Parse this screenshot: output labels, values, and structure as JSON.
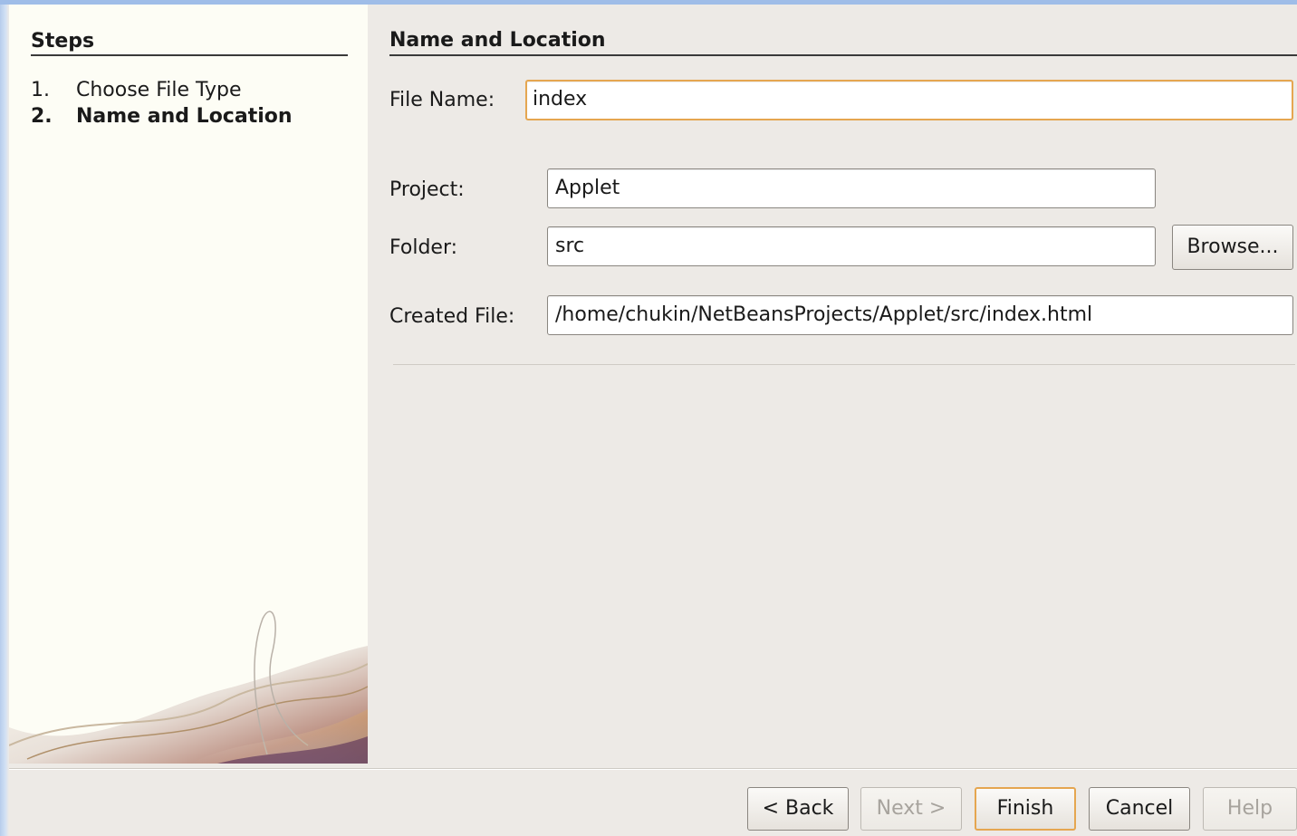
{
  "steps": {
    "title": "Steps",
    "items": [
      {
        "num": "1.",
        "label": "Choose File Type",
        "current": false
      },
      {
        "num": "2.",
        "label": "Name and Location",
        "current": true
      }
    ]
  },
  "panel": {
    "title": "Name and Location",
    "file_name_label": "File Name:",
    "file_name_value": "index",
    "project_label": "Project:",
    "project_value": "Applet",
    "folder_label": "Folder:",
    "folder_value": "src",
    "browse_label": "Browse...",
    "created_file_label": "Created File:",
    "created_file_value": "/home/chukin/NetBeansProjects/Applet/src/index.html"
  },
  "buttons": {
    "back": "< Back",
    "next": "Next >",
    "finish": "Finish",
    "cancel": "Cancel",
    "help": "Help"
  },
  "colors": {
    "focus_border": "#e5a650",
    "dialog_background": "#edeae6",
    "steps_background": "#fdfdf5"
  }
}
